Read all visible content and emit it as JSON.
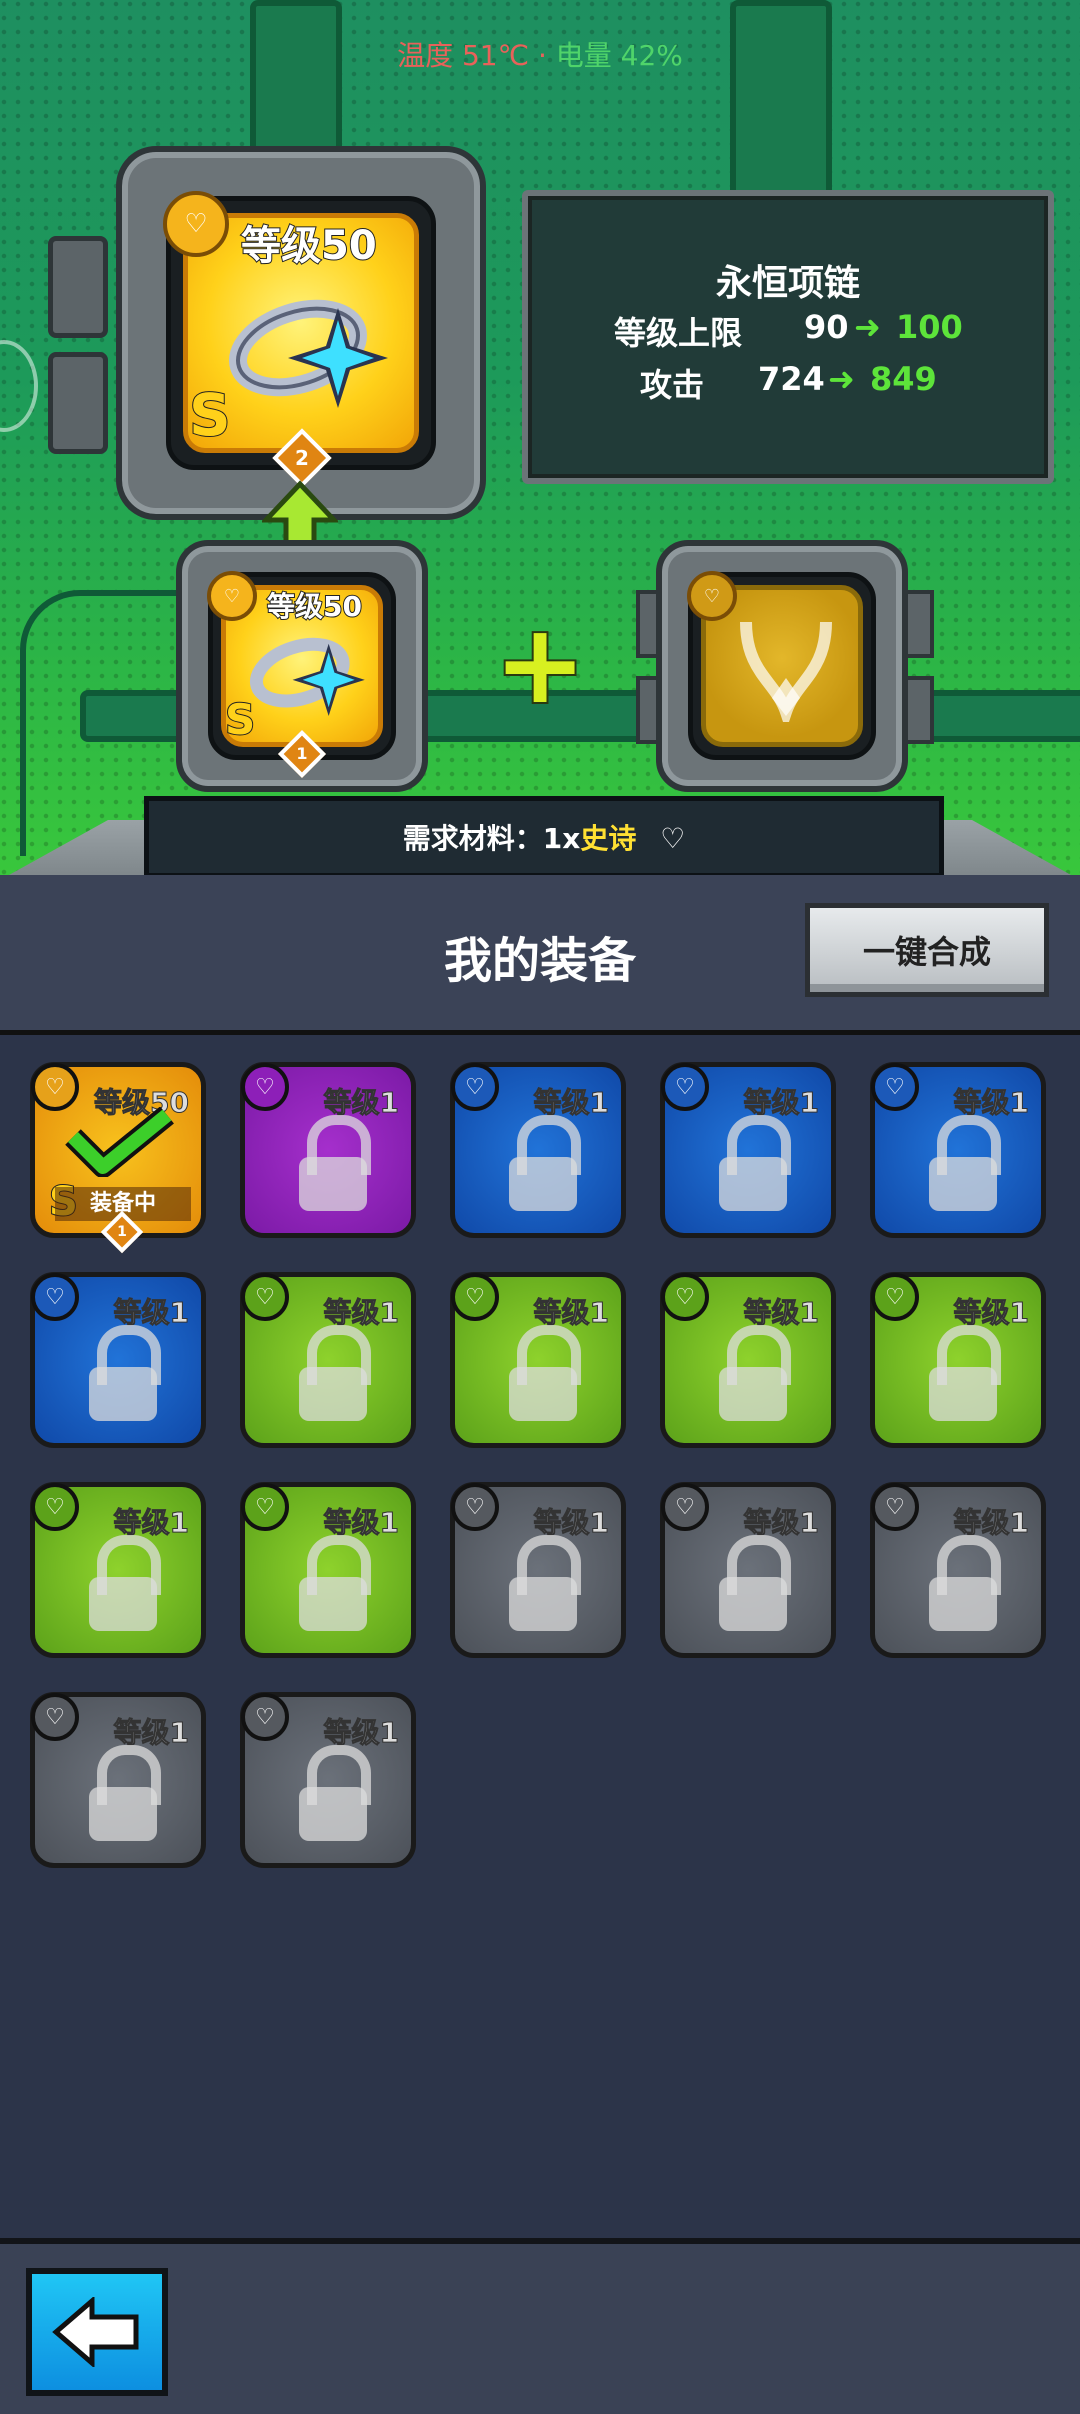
{
  "status": {
    "temp_label": "温度 51℃",
    "separator": "·",
    "battery_label": "电量 42%"
  },
  "merge": {
    "result": {
      "level_label": "等级50",
      "rank": "S",
      "stars": "2"
    },
    "source": {
      "level_label": "等级50",
      "rank": "S",
      "stars": "1"
    },
    "plus_symbol": "+"
  },
  "info": {
    "item_name": "永恒项链",
    "stats": [
      {
        "label": "等级上限",
        "from": "90",
        "to": "100"
      },
      {
        "label": "攻击",
        "from": "724",
        "to": "849"
      }
    ]
  },
  "requirement": {
    "prefix": "需求材料：1x",
    "rarity": "史诗"
  },
  "inventory": {
    "title": "我的装备",
    "merge_all_label": "一键合成",
    "items": [
      {
        "level": "等级50",
        "color": "orange",
        "equipped": true,
        "equipped_label": "装备中",
        "rank": "S",
        "stars": "1"
      },
      {
        "level": "等级1",
        "color": "purple",
        "locked": true
      },
      {
        "level": "等级1",
        "color": "blue",
        "locked": true
      },
      {
        "level": "等级1",
        "color": "blue",
        "locked": true
      },
      {
        "level": "等级1",
        "color": "blue",
        "locked": true
      },
      {
        "level": "等级1",
        "color": "blue",
        "locked": true
      },
      {
        "level": "等级1",
        "color": "lime",
        "locked": true
      },
      {
        "level": "等级1",
        "color": "lime",
        "locked": true
      },
      {
        "level": "等级1",
        "color": "lime",
        "locked": true
      },
      {
        "level": "等级1",
        "color": "lime",
        "locked": true
      },
      {
        "level": "等级1",
        "color": "lime",
        "locked": true
      },
      {
        "level": "等级1",
        "color": "lime",
        "locked": true
      },
      {
        "level": "等级1",
        "color": "gray",
        "locked": true
      },
      {
        "level": "等级1",
        "color": "gray",
        "locked": true
      },
      {
        "level": "等级1",
        "color": "gray",
        "locked": true
      },
      {
        "level": "等级1",
        "color": "gray",
        "locked": true
      },
      {
        "level": "等级1",
        "color": "gray",
        "locked": true
      }
    ]
  },
  "footer": {
    "back_icon": "arrow-left-icon"
  }
}
